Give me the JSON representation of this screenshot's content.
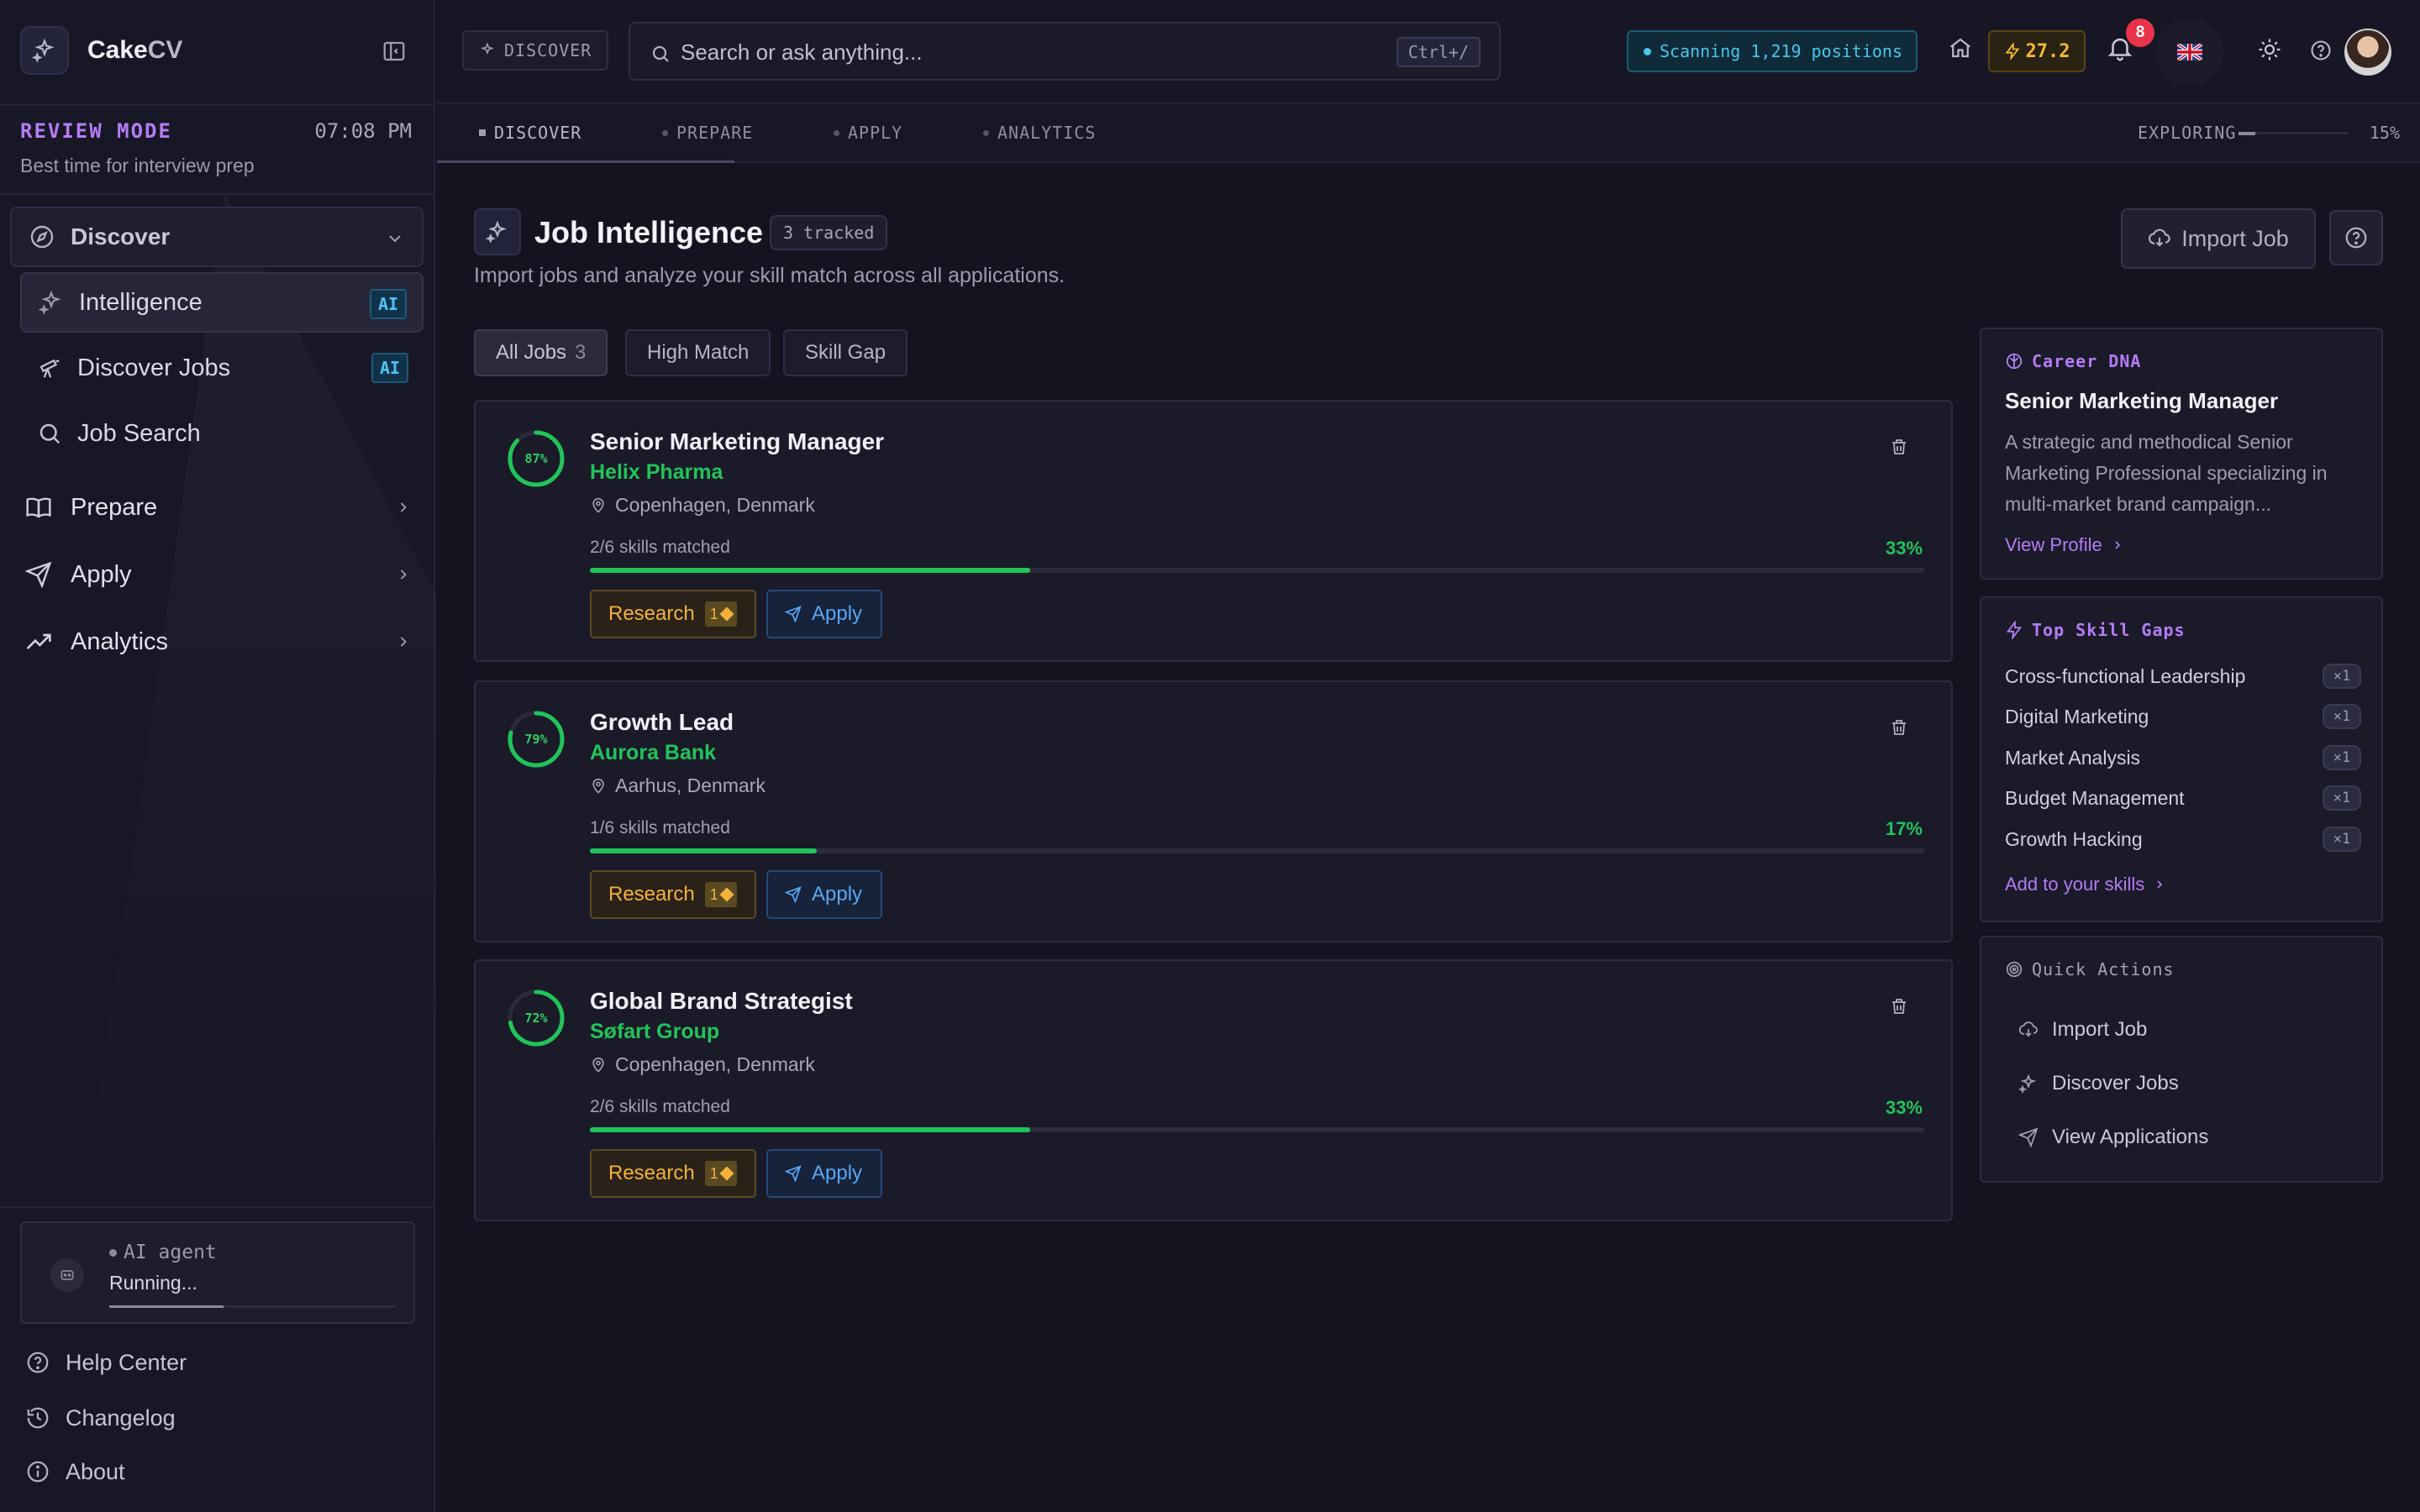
{
  "brand": {
    "name_main": "Cake",
    "name_accent": "CV"
  },
  "sidebar": {
    "review_mode": {
      "title": "REVIEW MODE",
      "time": "07:08 PM",
      "subtitle": "Best time for interview prep"
    },
    "discover_group": {
      "label": "Discover",
      "expanded": true
    },
    "sub_items": [
      {
        "label": "Intelligence",
        "badge": "AI",
        "active": true,
        "icon": "sparkle-icon"
      },
      {
        "label": "Discover Jobs",
        "badge": "AI",
        "active": false,
        "icon": "telescope-icon"
      },
      {
        "label": "Job Search",
        "badge": "",
        "active": false,
        "icon": "search-icon"
      }
    ],
    "groups": [
      {
        "label": "Prepare",
        "icon": "book-icon"
      },
      {
        "label": "Apply",
        "icon": "send-icon"
      },
      {
        "label": "Analytics",
        "icon": "trending-up-icon"
      }
    ],
    "agent": {
      "name": "AI agent",
      "status": "Running..."
    },
    "footer": [
      {
        "label": "Help Center",
        "icon": "help-circle-icon"
      },
      {
        "label": "Changelog",
        "icon": "history-icon"
      },
      {
        "label": "About",
        "icon": "info-icon"
      }
    ]
  },
  "topbar": {
    "crumb": "DISCOVER",
    "search": {
      "placeholder": "Search or ask anything...",
      "shortcut": "Ctrl+/"
    },
    "scanning": "Scanning 1,219 positions",
    "score": "27.2",
    "notifications": "8",
    "flag": "🇬🇧"
  },
  "stages": {
    "items": [
      "DISCOVER",
      "PREPARE",
      "APPLY",
      "ANALYTICS"
    ],
    "active": "DISCOVER",
    "exploring_label": "EXPLORING",
    "exploring_pct": "15%",
    "exploring_value": 0.15
  },
  "page": {
    "title": "Job Intelligence",
    "tracked": "3 tracked",
    "subtitle": "Import jobs and analyze your skill match across all applications.",
    "import_label": "Import Job"
  },
  "filters": [
    {
      "label": "All Jobs",
      "count": "3",
      "active": true
    },
    {
      "label": "High Match",
      "count": "",
      "active": false
    },
    {
      "label": "Skill Gap",
      "count": "",
      "active": false
    }
  ],
  "jobs": [
    {
      "match": "87%",
      "match_value": 0.87,
      "title": "Senior Marketing Manager",
      "company": "Helix Pharma",
      "location": "Copenhagen, Denmark",
      "skills": "2/6 skills matched",
      "skills_pct": "33%",
      "skills_value": 0.33,
      "research": "Research",
      "credit": "1",
      "apply": "Apply"
    },
    {
      "match": "79%",
      "match_value": 0.79,
      "title": "Growth Lead",
      "company": "Aurora Bank",
      "location": "Aarhus, Denmark",
      "skills": "1/6 skills matched",
      "skills_pct": "17%",
      "skills_value": 0.17,
      "research": "Research",
      "credit": "1",
      "apply": "Apply"
    },
    {
      "match": "72%",
      "match_value": 0.72,
      "title": "Global Brand Strategist",
      "company": "Søfart Group",
      "location": "Copenhagen, Denmark",
      "skills": "2/6 skills matched",
      "skills_pct": "33%",
      "skills_value": 0.33,
      "research": "Research",
      "credit": "1",
      "apply": "Apply"
    }
  ],
  "career_dna": {
    "heading": "Career DNA",
    "title": "Senior Marketing Manager",
    "description": "A strategic and methodical Senior Marketing Professional specializing in multi-market brand campaign...",
    "link": "View Profile"
  },
  "skill_gaps": {
    "heading": "Top Skill Gaps",
    "items": [
      {
        "label": "Cross-functional Leadership",
        "count": "×1"
      },
      {
        "label": "Digital Marketing",
        "count": "×1"
      },
      {
        "label": "Market Analysis",
        "count": "×1"
      },
      {
        "label": "Budget Management",
        "count": "×1"
      },
      {
        "label": "Growth Hacking",
        "count": "×1"
      }
    ],
    "link": "Add to your skills"
  },
  "quick_actions": {
    "heading": "Quick Actions",
    "items": [
      {
        "label": "Import Job",
        "icon": "cloud-download-icon"
      },
      {
        "label": "Discover Jobs",
        "icon": "sparkle-icon"
      },
      {
        "label": "View Applications",
        "icon": "send-icon"
      }
    ]
  },
  "colors": {
    "accent_purple": "#b57cf5",
    "match_green": "#21c45a",
    "info_cyan": "#48c6ee",
    "warn_amber": "#f4b23b",
    "badge_red": "#e8334a"
  }
}
